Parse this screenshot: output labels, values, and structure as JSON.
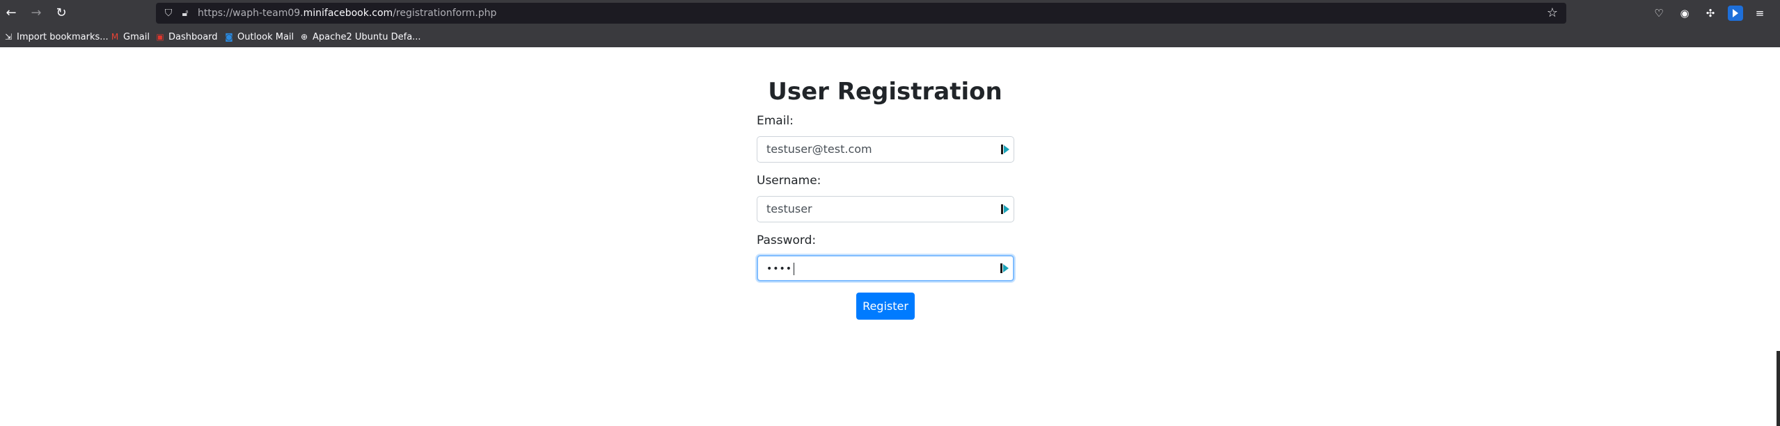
{
  "browser": {
    "url_prefix": "https://waph-team09.",
    "url_domain": "minifacebook.com",
    "url_path": "/registrationform.php",
    "bookmarks": [
      {
        "label": "Import bookmarks...",
        "icon": "import-icon"
      },
      {
        "label": "Gmail",
        "icon": "gmail-icon"
      },
      {
        "label": "Dashboard",
        "icon": "dashboard-icon"
      },
      {
        "label": "Outlook Mail",
        "icon": "outlook-icon"
      },
      {
        "label": "Apache2 Ubuntu Defa...",
        "icon": "globe-icon"
      }
    ]
  },
  "page": {
    "title": "User Registration",
    "email_label": "Email:",
    "email_value": "testuser@test.com",
    "username_label": "Username:",
    "username_value": "testuser",
    "password_label": "Password:",
    "password_value": "••••",
    "register_label": "Register"
  },
  "colors": {
    "chrome_bg": "#3a3a3e",
    "urlbar_bg": "#1c1b22",
    "button_primary": "#007bff",
    "focus_border": "#80bdff"
  }
}
